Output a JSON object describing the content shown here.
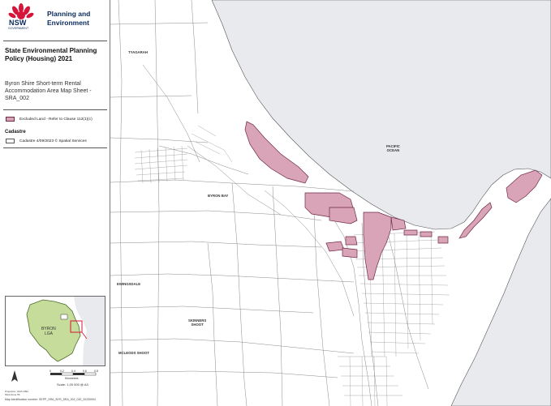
{
  "header": {
    "department_line1": "Planning and",
    "department_line2": "Environment",
    "logo_wordmark": "NSW",
    "logo_sub": "GOVERNMENT"
  },
  "title": {
    "line1": "State Environmental Planning",
    "line2": "Policy (Housing) 2021"
  },
  "subtitle": {
    "line1": "Byron Shire Short-term Rental",
    "line2": "Accommodation Area Map Sheet -",
    "line3": "SRA_002"
  },
  "legend": {
    "excluded_label": "Excluded Land - Refer to Clause 112(1)(c)",
    "cadastre_heading": "Cadastre",
    "cadastre_label": "Cadastre 4/09/2023 © Spatial Services"
  },
  "colors": {
    "excluded_fill": "#d9a3b8",
    "excluded_stroke": "#6e2a45",
    "ocean": "#e9eaee",
    "lga_fill": "#c5dc9a"
  },
  "inset": {
    "lga_label_line1": "BYRON",
    "lga_label_line2": "LGA"
  },
  "scale": {
    "ticks": [
      "0",
      "0.2",
      "0.4",
      "0.6",
      "0.8"
    ],
    "unit": "Kilometres",
    "text": "Scale: 1:20 000 @ A3"
  },
  "projection": {
    "line1": "Projection: GDA 1994",
    "line2": "MGA Zone 56"
  },
  "footer": {
    "map_id": "Map identification number: SEPP_SRA_BYR_SRA_002_020_20230904"
  },
  "map_labels": {
    "tyagarah": "TYAGARAH",
    "byron_bay": "BYRON BAY",
    "pacific_ocean_line1": "PACIFIC",
    "pacific_ocean_line2": "OCEAN",
    "ewingsdale": "EWINGSDALE",
    "skinners_shoot_line1": "SKINNERS",
    "skinners_shoot_line2": "SHOOT",
    "mcleods_shoot": "MCLEODS SHOOT"
  }
}
